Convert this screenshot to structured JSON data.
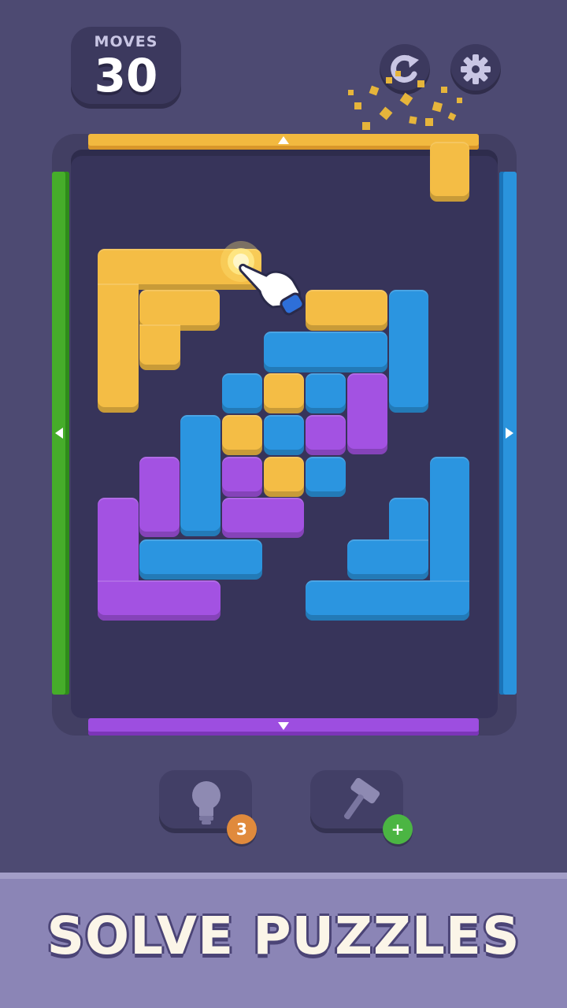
{
  "hud": {
    "moves_label": "MOVES",
    "moves_value": "30",
    "restart_icon": "restart-icon",
    "settings_icon": "gear-icon"
  },
  "board": {
    "gate_colors": {
      "top": "#f2b93f",
      "bottom": "#9d4ee0",
      "left": "#46ad2a",
      "right": "#2a93dc"
    },
    "block_colors": {
      "yellow": "#f4bd45",
      "blue": "#2b95e0",
      "purple": "#a352e2"
    }
  },
  "tools": {
    "hint_icon": "lightbulb-icon",
    "hint_count": "3",
    "hammer_icon": "hammer-icon",
    "hammer_add": "+"
  },
  "banner": {
    "text": "SOLVE PUZZLES"
  }
}
